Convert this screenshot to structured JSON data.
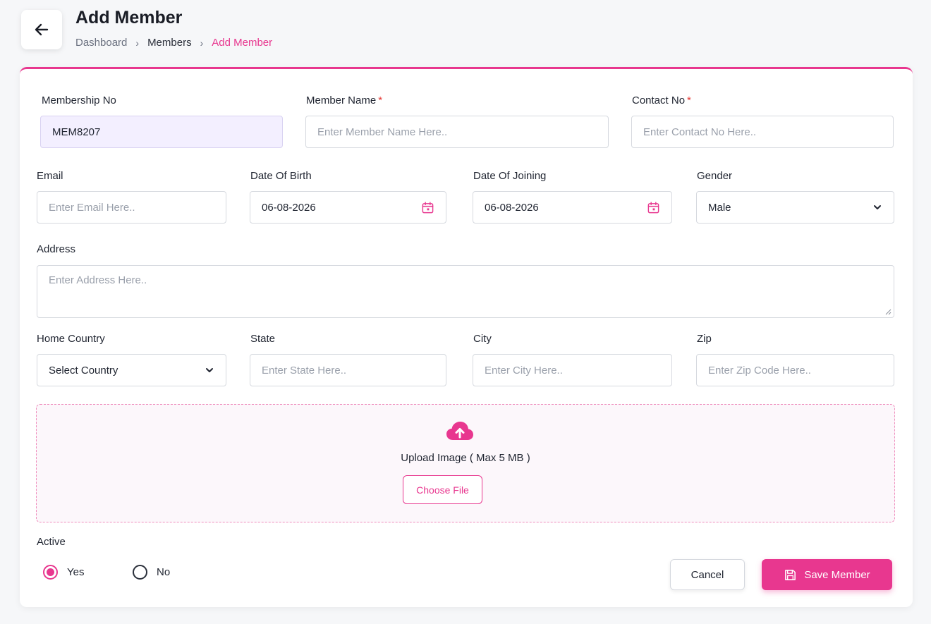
{
  "header": {
    "title": "Add Member",
    "breadcrumb": [
      "Dashboard",
      "Members",
      "Add Member"
    ]
  },
  "form": {
    "membership_no": {
      "label": "Membership No",
      "value": "MEM8207"
    },
    "member_name": {
      "label": "Member Name",
      "required_mark": "*",
      "placeholder": "Enter Member Name Here.."
    },
    "contact_no": {
      "label": "Contact No",
      "required_mark": "*",
      "placeholder": "Enter Contact No Here.."
    },
    "email": {
      "label": "Email",
      "placeholder": "Enter Email Here.."
    },
    "date_of_birth": {
      "label": "Date Of Birth",
      "value": "06-08-2026"
    },
    "date_of_joining": {
      "label": "Date Of Joining",
      "value": "06-08-2026"
    },
    "gender": {
      "label": "Gender",
      "value": "Male"
    },
    "address": {
      "label": "Address",
      "placeholder": "Enter Address Here.."
    },
    "home_country": {
      "label": "Home Country",
      "value": "Select Country"
    },
    "state": {
      "label": "State",
      "placeholder": "Enter State Here.."
    },
    "city": {
      "label": "City",
      "placeholder": "Enter City Here.."
    },
    "zip": {
      "label": "Zip",
      "placeholder": "Enter Zip Code Here.."
    },
    "upload": {
      "text": "Upload Image ( Max 5 MB )",
      "button": "Choose File",
      "icon": "cloud-upload-icon"
    },
    "active": {
      "label": "Active",
      "options": [
        "Yes",
        "No"
      ],
      "selected": "Yes"
    }
  },
  "actions": {
    "cancel": "Cancel",
    "save": "Save Member"
  },
  "colors": {
    "accent": "#e8378f",
    "readonly_bg": "#f3efff",
    "required": "#e53935"
  }
}
